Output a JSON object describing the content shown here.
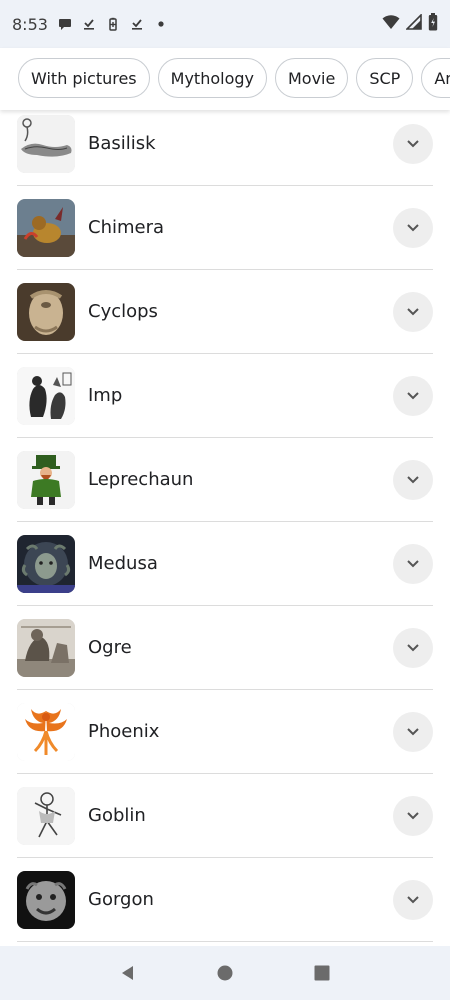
{
  "status_bar": {
    "time": "8:53",
    "left_icons": [
      "chat-bubble-icon",
      "download-check-icon",
      "battery-saver-icon",
      "download-check-icon",
      "dot-icon"
    ],
    "right_icons": [
      "wifi-icon",
      "signal-icon",
      "battery-icon"
    ]
  },
  "chips": [
    {
      "label": "With pictures"
    },
    {
      "label": "Mythology"
    },
    {
      "label": "Movie"
    },
    {
      "label": "SCP"
    },
    {
      "label": "Ancien"
    }
  ],
  "creatures": [
    {
      "name": "Basilisk",
      "thumb": "basilisk-image"
    },
    {
      "name": "Chimera",
      "thumb": "chimera-image"
    },
    {
      "name": "Cyclops",
      "thumb": "cyclops-image"
    },
    {
      "name": "Imp",
      "thumb": "imp-image"
    },
    {
      "name": "Leprechaun",
      "thumb": "leprechaun-image"
    },
    {
      "name": "Medusa",
      "thumb": "medusa-image"
    },
    {
      "name": "Ogre",
      "thumb": "ogre-image"
    },
    {
      "name": "Phoenix",
      "thumb": "phoenix-image"
    },
    {
      "name": "Goblin",
      "thumb": "goblin-image"
    },
    {
      "name": "Gorgon",
      "thumb": "gorgon-image"
    }
  ],
  "nav": {
    "icons": [
      "back-icon",
      "home-icon",
      "recents-icon"
    ]
  },
  "colors": {
    "system_bar": "#eef2f8",
    "chip_border": "#c9cdd2",
    "expand_button": "#eeeeee",
    "divider": "#dcdcdc"
  }
}
